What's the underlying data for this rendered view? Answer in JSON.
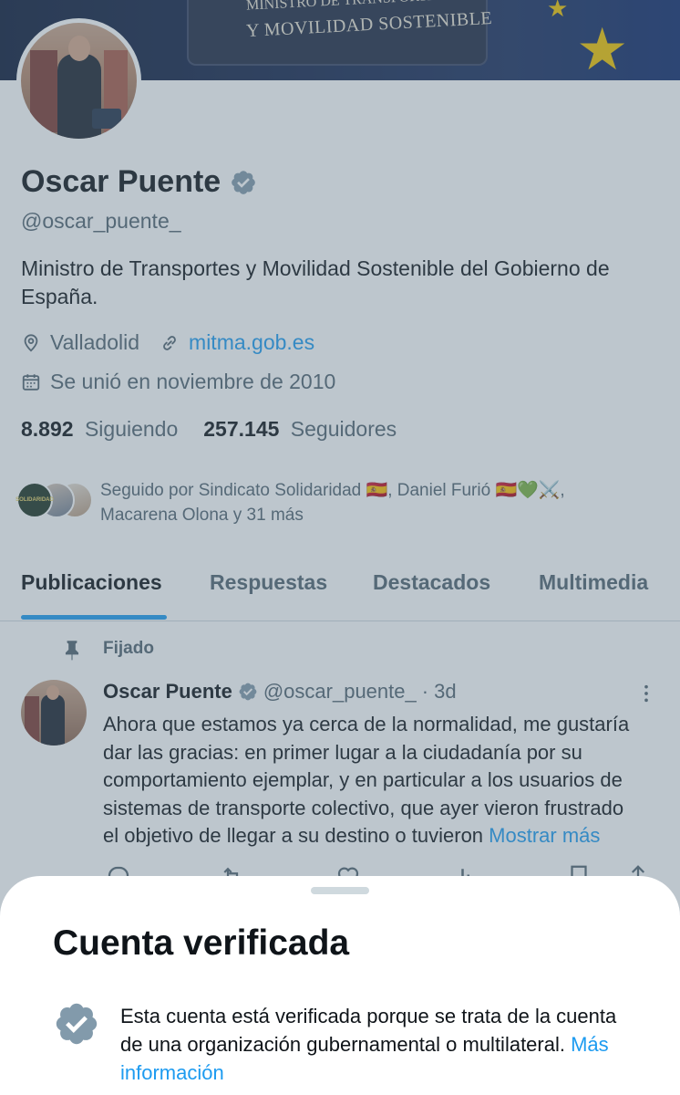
{
  "banner": {
    "line1": "MINISTRO DE TRANSPORTES",
    "line2": "Y MOVILIDAD SOSTENIBLE"
  },
  "profile": {
    "name": "Oscar Puente",
    "handle": "@oscar_puente_",
    "bio": "Ministro de Transportes y Movilidad Sostenible del Gobierno de España.",
    "location": "Valladolid",
    "website": "mitma.gob.es",
    "joined": "Se unió en noviembre de 2010",
    "following_count": "8.892",
    "following_label": "Siguiendo",
    "followers_count": "257.145",
    "followers_label": "Seguidores",
    "followed_by_line1": "Seguido por Sindicato Solidaridad 🇪🇸, Daniel Furió 🇪🇸💚⚔️,",
    "followed_by_line2": "Macarena Olona y 31 más",
    "avatar1_text": "SOLIDARIDAD"
  },
  "tabs": [
    {
      "label": "Publicaciones",
      "active": true
    },
    {
      "label": "Respuestas",
      "active": false
    },
    {
      "label": "Destacados",
      "active": false
    },
    {
      "label": "Multimedia",
      "active": false
    }
  ],
  "post": {
    "pinned_label": "Fijado",
    "author": "Oscar Puente",
    "handle": "@oscar_puente_",
    "time": "· 3d",
    "lines": [
      "Ahora que estamos ya cerca de la normalidad, me gustaría",
      "dar las gracias: en primer lugar a la ciudadanía por su",
      "comportamiento ejemplar, y en particular a los usuarios de",
      "sistemas de transporte colectivo, que ayer vieron frustrado",
      "el objetivo de llegar a su destino o tuvieron"
    ],
    "show_more": "Mostrar más"
  },
  "sheet": {
    "title": "Cuenta verificada",
    "text": "Esta cuenta está verificada porque se trata de la cuenta de una organización gubernamental o multilateral.",
    "more_link": "Más información"
  },
  "colors": {
    "accent": "#1d9bf0",
    "secondary_text": "#536471",
    "verified_gray": "#829aab",
    "overlay": "rgba(91,112,131,0.40)"
  }
}
